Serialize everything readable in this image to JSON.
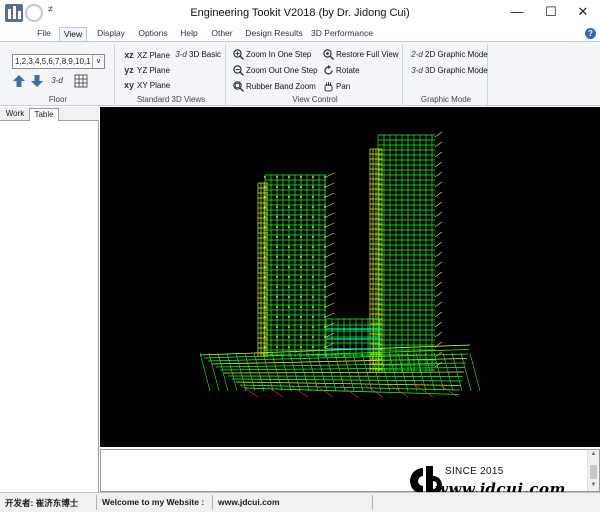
{
  "window": {
    "title": "Engineering Tookit V2018 (by Dr. Jidong Cui)",
    "qa_menu_glyph": "≠",
    "minimize_glyph": "—",
    "maximize_glyph": "☐",
    "close_glyph": "✕"
  },
  "tabs": [
    "File",
    "View",
    "Display",
    "Options",
    "Help",
    "Other",
    "Design Results",
    "3D Performance"
  ],
  "active_tab": "View",
  "help_glyph": "?",
  "ribbon": {
    "floor": {
      "label": "Floor",
      "select_value": "1,2,3,4,5,6,7,8,9,10,1",
      "select_arrow": "∨",
      "button_3d": "3-d"
    },
    "views": {
      "label": "Standard 3D Views",
      "xz_icon": "xz",
      "xz_plane": "XZ Plane",
      "yz_icon": "yz",
      "yz_plane": "YZ Plane",
      "xy_icon": "xy",
      "xy_plane": "XY Plane",
      "basic_icon": "3-d",
      "basic": "3D Basic"
    },
    "view_control": {
      "label": "View Control",
      "zoom_in": "Zoom In One Step",
      "zoom_out": "Zoom Out One Step",
      "rubber_band": "Rubber Band Zoom",
      "restore": "Restore Full View",
      "rotate": "Rotate",
      "pan": "Pan"
    },
    "graphic_mode": {
      "label": "Graphic Mode",
      "mode_2d_icon": "2-d",
      "mode_2d": "2D Graphic Mode",
      "mode_3d_icon": "3-d",
      "mode_3d": "3D Graphic Mode"
    }
  },
  "left_panel": {
    "tabs": [
      "Work",
      "Table"
    ],
    "active": "Table"
  },
  "watermark": {
    "since": "SINCE 2015",
    "url": "www.jdcui.com"
  },
  "statusbar": {
    "developer": "开发者: 崔济东博士",
    "welcome": "Welcome to my Website :",
    "website": "www.jdcui.com"
  },
  "colors": {
    "wire_green": "#19ff19",
    "wire_yellow": "#e6ff1a",
    "wire_cyan": "#00e6e6",
    "wire_red": "#ff3030",
    "viewport_bg": "#000000"
  }
}
